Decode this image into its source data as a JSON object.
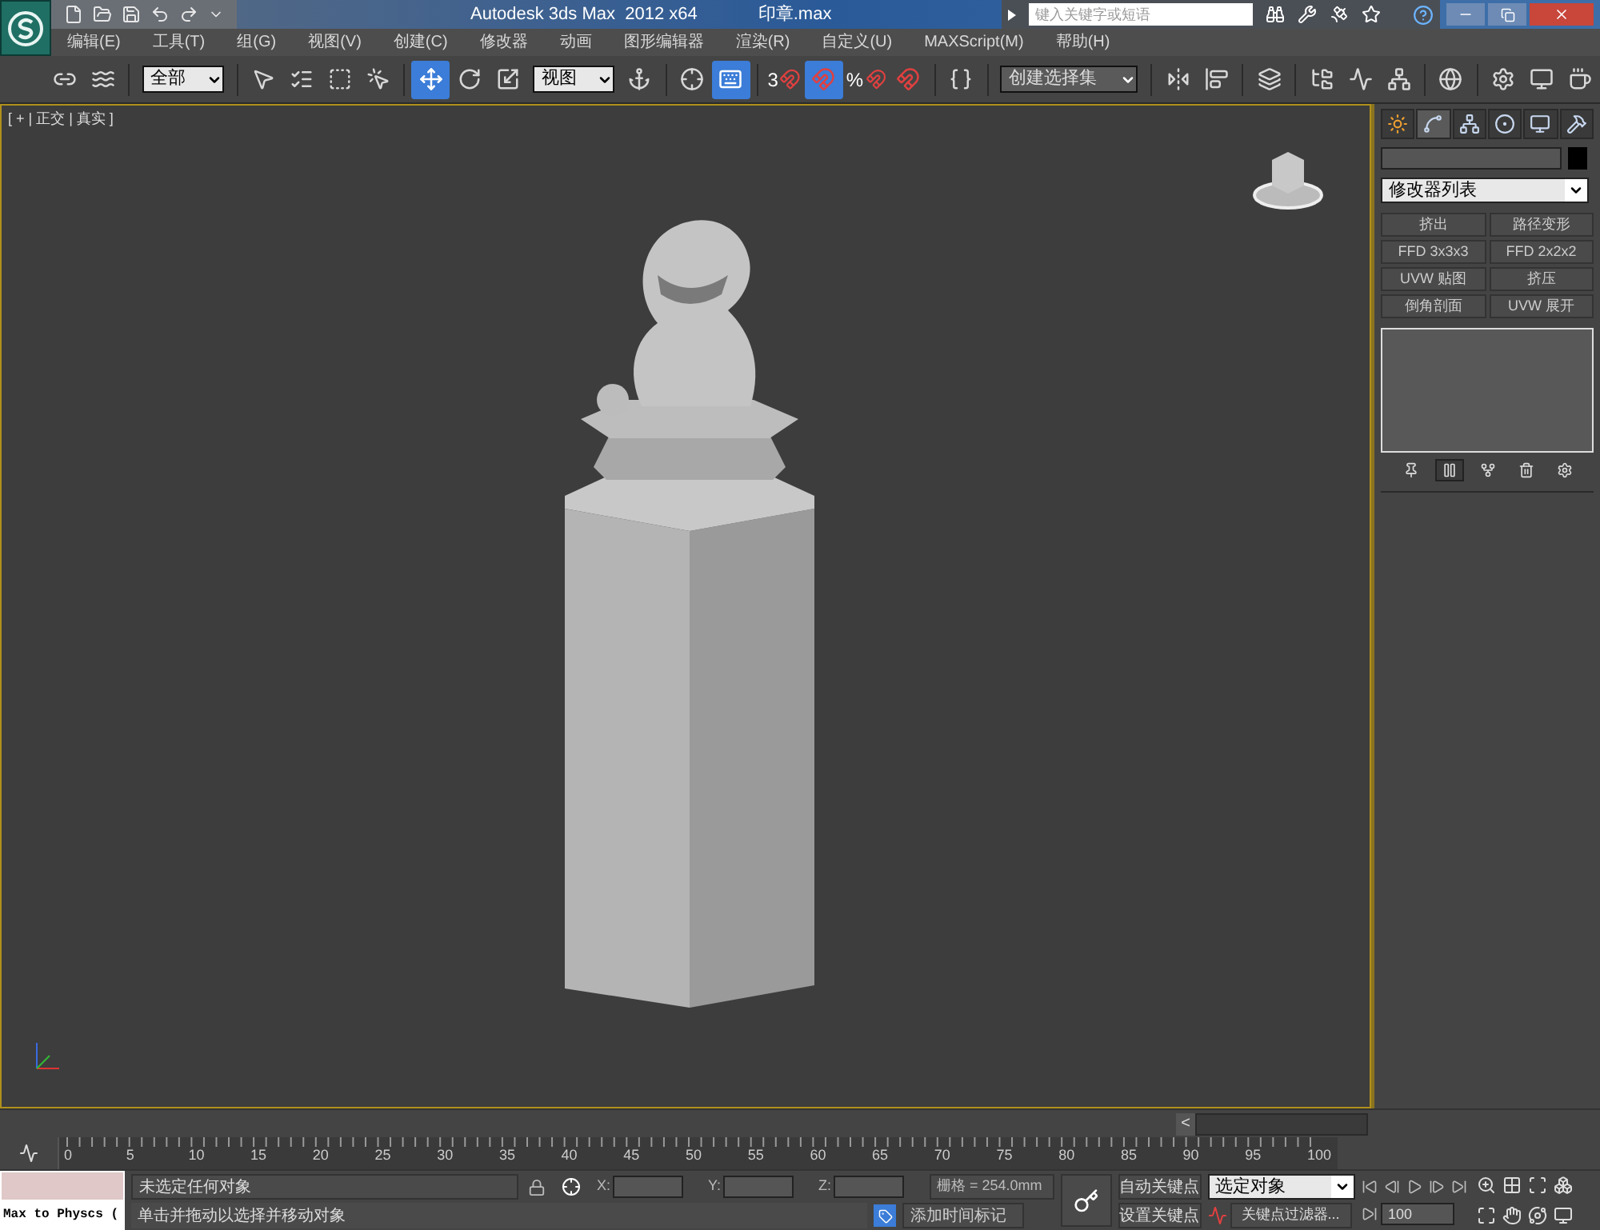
{
  "title_bar": {
    "app_title": "Autodesk 3ds Max  2012 x64",
    "file_name": "印章.max",
    "search": {
      "placeholder": "键入关键字或短语"
    }
  },
  "menu": [
    "编辑(E)",
    "工具(T)",
    "组(G)",
    "视图(V)",
    "创建(C)",
    "修改器",
    "动画",
    "图形编辑器",
    "渲染(R)",
    "自定义(U)",
    "MAXScript(M)",
    "帮助(H)"
  ],
  "toolbar": [
    {
      "kind": "tool",
      "selected": false
    },
    {
      "kind": "tool",
      "selected": false
    },
    {
      "kind": "dropdown",
      "value": "全部"
    },
    {
      "kind": "tool",
      "selected": false
    },
    {
      "kind": "tool",
      "selected": false
    },
    {
      "kind": "tool",
      "selected": false
    },
    {
      "kind": "tool",
      "selected": false
    },
    {
      "kind": "tool",
      "selected": true
    },
    {
      "kind": "tool",
      "selected": false
    },
    {
      "kind": "tool",
      "selected": false
    },
    {
      "kind": "dropdown",
      "value": "视图"
    },
    {
      "kind": "tool",
      "selected": false
    },
    {
      "kind": "tool",
      "selected": false
    },
    {
      "kind": "tool",
      "selected": true
    },
    {
      "kind": "tool",
      "selected": false,
      "label": "3"
    },
    {
      "kind": "tool",
      "selected": true
    },
    {
      "kind": "tool",
      "selected": false,
      "label": "%"
    },
    {
      "kind": "tool",
      "selected": false
    },
    {
      "kind": "tool",
      "selected": false
    },
    {
      "kind": "dropdown",
      "value": "创建选择集"
    },
    {
      "kind": "tool",
      "selected": false
    },
    {
      "kind": "tool",
      "selected": false
    },
    {
      "kind": "tool",
      "selected": false
    },
    {
      "kind": "tool",
      "selected": false
    },
    {
      "kind": "tool",
      "selected": false
    },
    {
      "kind": "tool",
      "selected": false
    },
    {
      "kind": "tool",
      "selected": false
    },
    {
      "kind": "tool",
      "selected": false
    },
    {
      "kind": "tool",
      "selected": false
    },
    {
      "kind": "tool",
      "selected": false
    }
  ],
  "viewport": {
    "label": "[ + | 正交 | 真实 ]"
  },
  "command_panel": {
    "tabs": [
      {
        "selected": false
      },
      {
        "selected": true
      },
      {
        "selected": false
      },
      {
        "selected": false
      },
      {
        "selected": false
      },
      {
        "selected": false
      }
    ],
    "modifier_list": "修改器列表",
    "modifier_buttons": [
      "挤出",
      "路径变形",
      "FFD 3x3x3",
      "FFD 2x2x2",
      "UVW 贴图",
      "挤压",
      "倒角剖面",
      "UVW 展开"
    ],
    "stack_tools": [
      {
        "selected": false
      },
      {
        "selected": true
      },
      {
        "selected": false
      },
      {
        "selected": false
      },
      {
        "selected": false
      }
    ]
  },
  "timeline": {
    "scroll_button": "<",
    "ticks": [
      "0",
      "5",
      "10",
      "15",
      "20",
      "25",
      "30",
      "35",
      "40",
      "45",
      "50",
      "55",
      "60",
      "65",
      "70",
      "75",
      "80",
      "85",
      "90",
      "95",
      "100"
    ]
  },
  "status_bar": {
    "listener_input": "Max to Physcs (",
    "selection_status": "未选定任何对象",
    "coords": [
      "X:",
      "Y:",
      "Z:"
    ],
    "grid": "栅格 = 254.0mm",
    "prompt": "单击并拖动以选择并移动对象",
    "add_time_tag": "添加时间标记",
    "auto_key": "自动关键点",
    "set_key": "设置关键点",
    "key_mode": "选定对象",
    "key_filters": "关键点过滤器...",
    "frame": "100"
  }
}
